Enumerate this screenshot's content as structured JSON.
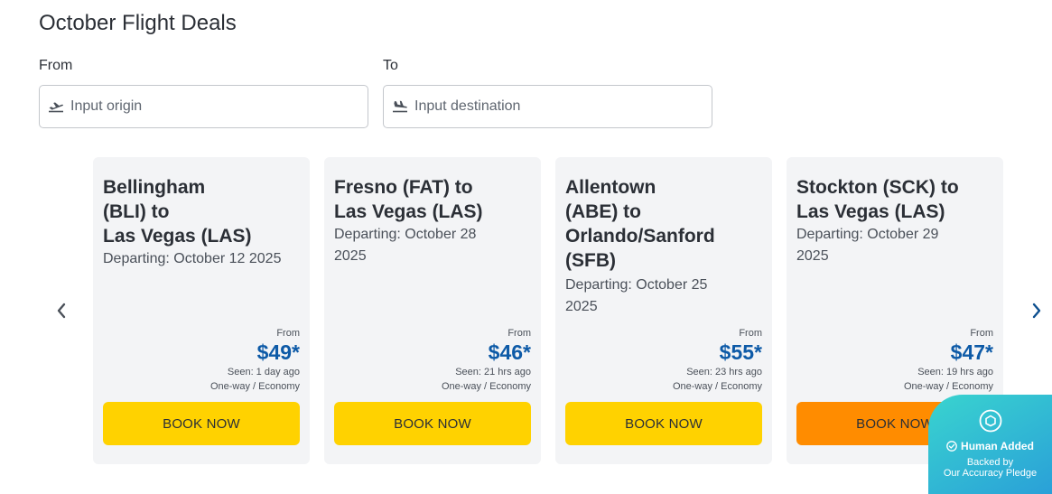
{
  "title": "October Flight Deals",
  "search": {
    "from_label": "From",
    "to_label": "To",
    "origin_placeholder": "Input origin",
    "destination_placeholder": "Input destination"
  },
  "cards": [
    {
      "route_lines": [
        "Bellingham",
        "(BLI) to",
        "Las Vegas (LAS)"
      ],
      "departing": "Departing: October 12 2025",
      "from_label": "From",
      "price": "$49*",
      "seen": "Seen: 1 day ago",
      "fare": "One-way / Economy",
      "button": "BOOK NOW"
    },
    {
      "route_lines": [
        "Fresno (FAT) to",
        "Las Vegas (LAS)"
      ],
      "departing_lines": [
        "Departing: October 28",
        "2025"
      ],
      "from_label": "From",
      "price": "$46*",
      "seen": "Seen: 21 hrs ago",
      "fare": "One-way / Economy",
      "button": "BOOK NOW"
    },
    {
      "route_lines": [
        "Allentown",
        "(ABE) to",
        "Orlando/Sanford",
        "(SFB)"
      ],
      "departing_lines": [
        "Departing: October 25",
        "2025"
      ],
      "from_label": "From",
      "price": "$55*",
      "seen": "Seen: 23 hrs ago",
      "fare": "One-way / Economy",
      "button": "BOOK NOW"
    },
    {
      "route_lines": [
        "Stockton (SCK) to",
        "Las Vegas (LAS)"
      ],
      "departing_lines": [
        "Departing: October 29",
        "2025"
      ],
      "from_label": "From",
      "price": "$47*",
      "seen": "Seen: 19 hrs ago",
      "fare": "One-way / Economy",
      "button": "BOOK NOW"
    }
  ],
  "badge": {
    "added": "Human Added",
    "backed_line1": "Backed by",
    "backed_line2": "Our Accuracy Pledge"
  },
  "colors": {
    "price": "#0d5aa7",
    "button": "#ffd200",
    "button_hover": "#ff8c00",
    "card_bg": "#f3f4f6"
  }
}
